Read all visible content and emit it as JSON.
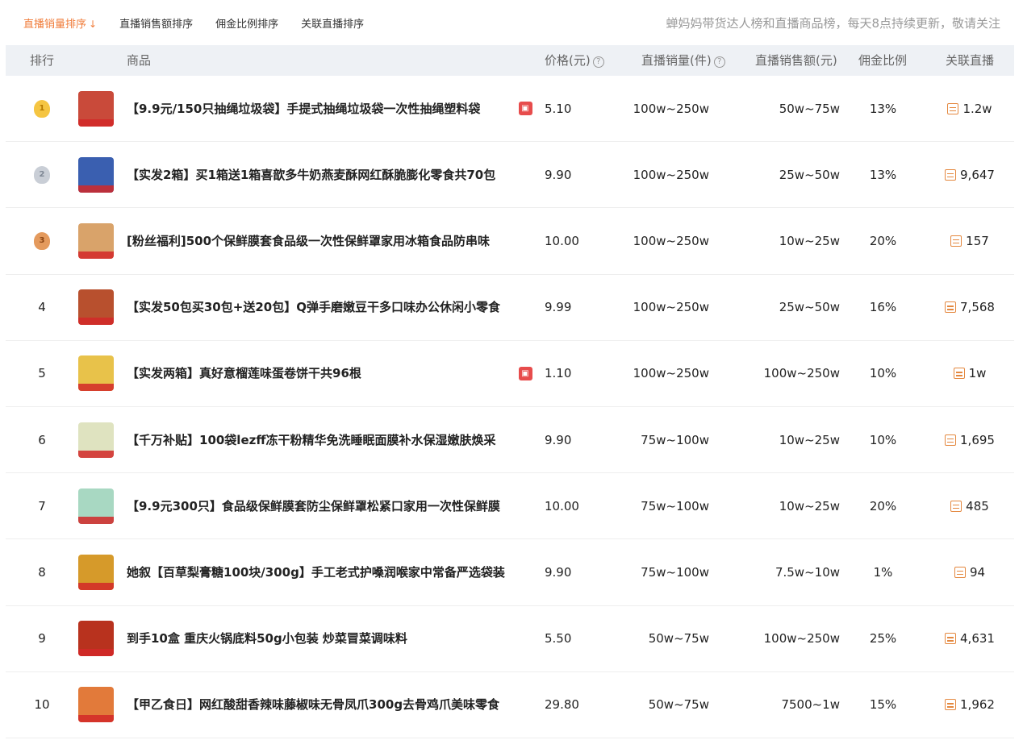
{
  "sort_tabs": [
    {
      "label": "直播销量排序",
      "active": true
    },
    {
      "label": "直播销售额排序",
      "active": false
    },
    {
      "label": "佣金比例排序",
      "active": false
    },
    {
      "label": "关联直播排序",
      "active": false
    }
  ],
  "notice": "蝉妈妈带货达人榜和直播商品榜，每天8点持续更新，敬请关注",
  "columns": {
    "rank": "排行",
    "product": "商品",
    "price": "价格(元)",
    "sales": "直播销量(件)",
    "amount": "直播销售额(元)",
    "commission": "佣金比例",
    "live": "关联直播"
  },
  "rows": [
    {
      "rank": "1",
      "title": "【9.9元/150只抽绳垃圾袋】手提式抽绳垃圾袋一次性抽绳塑料袋",
      "shop": true,
      "price": "5.10",
      "sales": "100w~250w",
      "amount": "50w~75w",
      "commission": "13%",
      "live": "1.2w",
      "thumb_color": "#c94a3a"
    },
    {
      "rank": "2",
      "title": "【实发2箱】买1箱送1箱喜歆多牛奶燕麦酥网红酥脆膨化零食共70包",
      "shop": false,
      "price": "9.90",
      "sales": "100w~250w",
      "amount": "25w~50w",
      "commission": "13%",
      "live": "9,647",
      "thumb_color": "#3a5fb0"
    },
    {
      "rank": "3",
      "title": "[粉丝福利]500个保鲜膜套食品级一次性保鲜罩家用冰箱食品防串味",
      "shop": false,
      "price": "10.00",
      "sales": "100w~250w",
      "amount": "10w~25w",
      "commission": "20%",
      "live": "157",
      "thumb_color": "#d9a36a"
    },
    {
      "rank": "4",
      "title": "【实发50包买30包+送20包】Q弹手磨嫩豆干多口味办公休闲小零食",
      "shop": false,
      "price": "9.99",
      "sales": "100w~250w",
      "amount": "25w~50w",
      "commission": "16%",
      "live": "7,568",
      "thumb_color": "#b8502e"
    },
    {
      "rank": "5",
      "title": "【实发两箱】真好意榴莲味蛋卷饼干共96根",
      "shop": true,
      "price": "1.10",
      "sales": "100w~250w",
      "amount": "100w~250w",
      "commission": "10%",
      "live": "1w",
      "thumb_color": "#e8c24a"
    },
    {
      "rank": "6",
      "title": "【千万补贴】100袋lezff冻干粉精华免洗睡眠面膜补水保湿嫩肤焕采",
      "shop": false,
      "price": "9.90",
      "sales": "75w~100w",
      "amount": "10w~25w",
      "commission": "10%",
      "live": "1,695",
      "thumb_color": "#dfe3c0"
    },
    {
      "rank": "7",
      "title": "【9.9元300只】食品级保鲜膜套防尘保鲜罩松紧口家用一次性保鲜膜",
      "shop": false,
      "price": "10.00",
      "sales": "75w~100w",
      "amount": "10w~25w",
      "commission": "20%",
      "live": "485",
      "thumb_color": "#a8d8c2"
    },
    {
      "rank": "8",
      "title": "她叙【百草梨膏糖100块/300g】手工老式护嗓润喉家中常备严选袋装",
      "shop": false,
      "price": "9.90",
      "sales": "75w~100w",
      "amount": "7.5w~10w",
      "commission": "1%",
      "live": "94",
      "thumb_color": "#d69a2a"
    },
    {
      "rank": "9",
      "title": "到手10盒 重庆火锅底料50g小包装 炒菜冒菜调味料",
      "shop": false,
      "price": "5.50",
      "sales": "50w~75w",
      "amount": "100w~250w",
      "commission": "25%",
      "live": "4,631",
      "thumb_color": "#b8321e"
    },
    {
      "rank": "10",
      "title": "【甲乙食日】网红酸甜香辣味藤椒味无骨凤爪300g去骨鸡爪美味零食",
      "shop": false,
      "price": "29.80",
      "sales": "50w~75w",
      "amount": "7500~1w",
      "commission": "15%",
      "live": "1,962",
      "thumb_color": "#e27a3a"
    }
  ]
}
